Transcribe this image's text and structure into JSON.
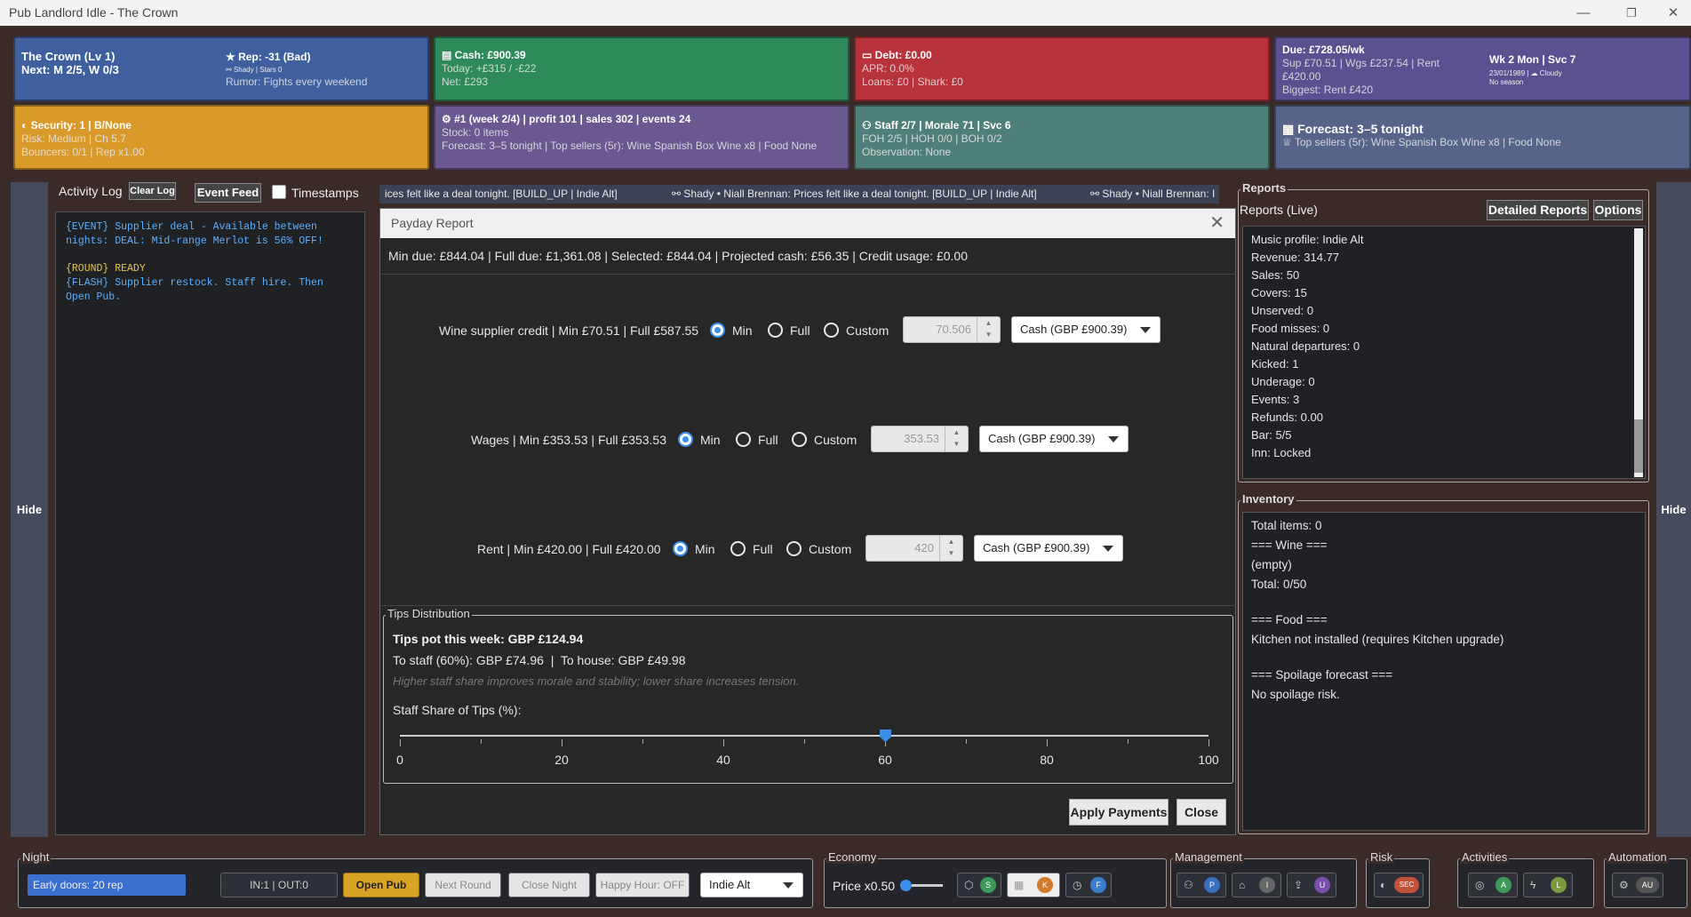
{
  "window": {
    "title": "Pub Landlord Idle - The Crown",
    "minimize": "—",
    "restore": "❐",
    "close": "✕"
  },
  "cards": {
    "pub": {
      "title": "The Crown (Lv 1)",
      "sub": "Next: M 2/5, W 0/3",
      "rep": "Rep: -31 (Bad)",
      "rep_small": "⚯ Shady | Stars 0",
      "rumor": "Rumor: Fights every weekend"
    },
    "cash": {
      "title": "Cash: £900.39",
      "today": "Today: +£315 / -£22",
      "net": "Net: £293"
    },
    "debt": {
      "title": "Debt: £0.00",
      "apr": "APR: 0.0%",
      "loans": "Loans: £0 | Shark: £0"
    },
    "due": {
      "title": "Due: £728.05/wk",
      "line1": "Sup £70.51 | Wgs £237.54 | Rent £420.00",
      "biggest": "Biggest: Rent £420",
      "week": "Wk 2 Mon | Svc 7",
      "date": "23/01/1989 | ☁ Cloudy",
      "season": "No season"
    },
    "security": {
      "title": "Security: 1 | B/None",
      "risk": "Risk: Medium | Ch 5.7",
      "bouncers": "Bouncers: 0/1 | Rep x1.00"
    },
    "week": {
      "title": "#1 (week 2/4) | profit 101 | sales 302 | events 24",
      "stock": "Stock: 0 items",
      "forecast": "Forecast: 3–5 tonight | Top sellers (5r): Wine Spanish Box Wine x8 | Food None"
    },
    "staff": {
      "title": "Staff 2/7 | Morale 71 | Svc 6",
      "foh": "FOH 2/5 | HOH 0/0 | BOH 0/2",
      "obs": "Observation: None"
    },
    "forecast": {
      "title": "Forecast: 3–5 tonight",
      "top": "Top sellers (5r): Wine Spanish Box Wine x8 | Food None"
    }
  },
  "left_hide": "Hide",
  "right_hide": "Hide",
  "activity": {
    "label": "Activity Log",
    "clear": "Clear Log",
    "event_feed": "Event Feed",
    "timestamps": "Timestamps",
    "l1": "{EVENT}  Supplier deal - Available between",
    "l2": "nights:  DEAL: Mid-range Merlot is 56% OFF!",
    "l3": "{ROUND} READY",
    "l4": "{FLASH} Supplier  restock. Staff  hire. Then",
    "l5": "Open Pub."
  },
  "ticker": {
    "a": "ices felt like a deal tonight. [BUILD_UP | Indie Alt]",
    "b": "⚯ Shady • Niall Brennan: Prices felt like a deal tonight. [BUILD_UP | Indie Alt]",
    "c": "⚯ Shady • Niall Brennan: I"
  },
  "payday": {
    "title": "Payday Report",
    "summary": "Min due: £844.04 | Full due: £1,361.08 | Selected: £844.04 | Projected cash: £56.35 | Credit usage: £0.00",
    "rows": [
      {
        "label": "Wine supplier credit | Min £70.51 | Full £587.55",
        "value": "70.506",
        "source": "Cash (GBP £900.39)"
      },
      {
        "label": "Wages | Min £353.53 | Full £353.53",
        "value": "353.53",
        "source": "Cash (GBP £900.39)"
      },
      {
        "label": "Rent | Min £420.00 | Full £420.00",
        "value": "420",
        "source": "Cash (GBP £900.39)"
      }
    ],
    "opt_min": "Min",
    "opt_full": "Full",
    "opt_custom": "Custom",
    "tips": {
      "group": "Tips Distribution",
      "pot": "Tips pot this week: GBP £124.94",
      "split": "To staff (60%): GBP £74.96  |  To house: GBP £49.98",
      "hint": "Higher staff share improves morale and stability; lower share increases tension.",
      "slider_label": "Staff Share of Tips (%):",
      "value": 60,
      "ticks": [
        "0",
        "20",
        "40",
        "60",
        "80",
        "100"
      ]
    },
    "apply": "Apply Payments",
    "close": "Close"
  },
  "reports": {
    "group": "Reports",
    "live": "Reports (Live)",
    "detailed": "Detailed Reports",
    "options": "Options",
    "lines": [
      "Music profile: Indie Alt",
      "Revenue:  314.77",
      "Sales:    50",
      "Covers:   15",
      "Unserved: 0",
      "Food misses: 0",
      "Natural departures: 0",
      "Kicked:    1",
      "Underage: 0",
      "Events:    3",
      "Refunds:  0.00",
      "Bar:       5/5",
      "Inn: Locked"
    ]
  },
  "inventory": {
    "group": "Inventory",
    "lines": [
      "Total items: 0",
      "=== Wine ===",
      "(empty)",
      "Total: 0/50",
      "",
      "=== Food ===",
      "Kitchen not installed (requires Kitchen upgrade)",
      "",
      "=== Spoilage forecast ===",
      "No spoilage risk."
    ]
  },
  "bottom": {
    "night": {
      "label": "Night",
      "status": "Early doors: 20 rep",
      "io": "IN:1 | OUT:0",
      "open": "Open Pub",
      "next": "Next Round",
      "close": "Close Night",
      "happy": "Happy Hour: OFF",
      "music": "Indie Alt"
    },
    "economy": {
      "label": "Economy",
      "price": "Price x0.50",
      "s": "S",
      "k": "K",
      "f": "F"
    },
    "management": {
      "label": "Management",
      "p": "P",
      "i": "I",
      "u": "U"
    },
    "risk": {
      "label": "Risk",
      "sec": "SEC"
    },
    "activities": {
      "label": "Activities",
      "a": "A",
      "l": "L"
    },
    "automation": {
      "label": "Automation",
      "au": "AU"
    }
  },
  "colors": {
    "blue": "#3f5f9f",
    "green": "#2e8a5a",
    "red": "#b8323c",
    "purple": "#5b5090",
    "orange": "#d99a2a",
    "mauve": "#6a5890",
    "teal": "#4e7f78",
    "slate": "#56648a"
  }
}
